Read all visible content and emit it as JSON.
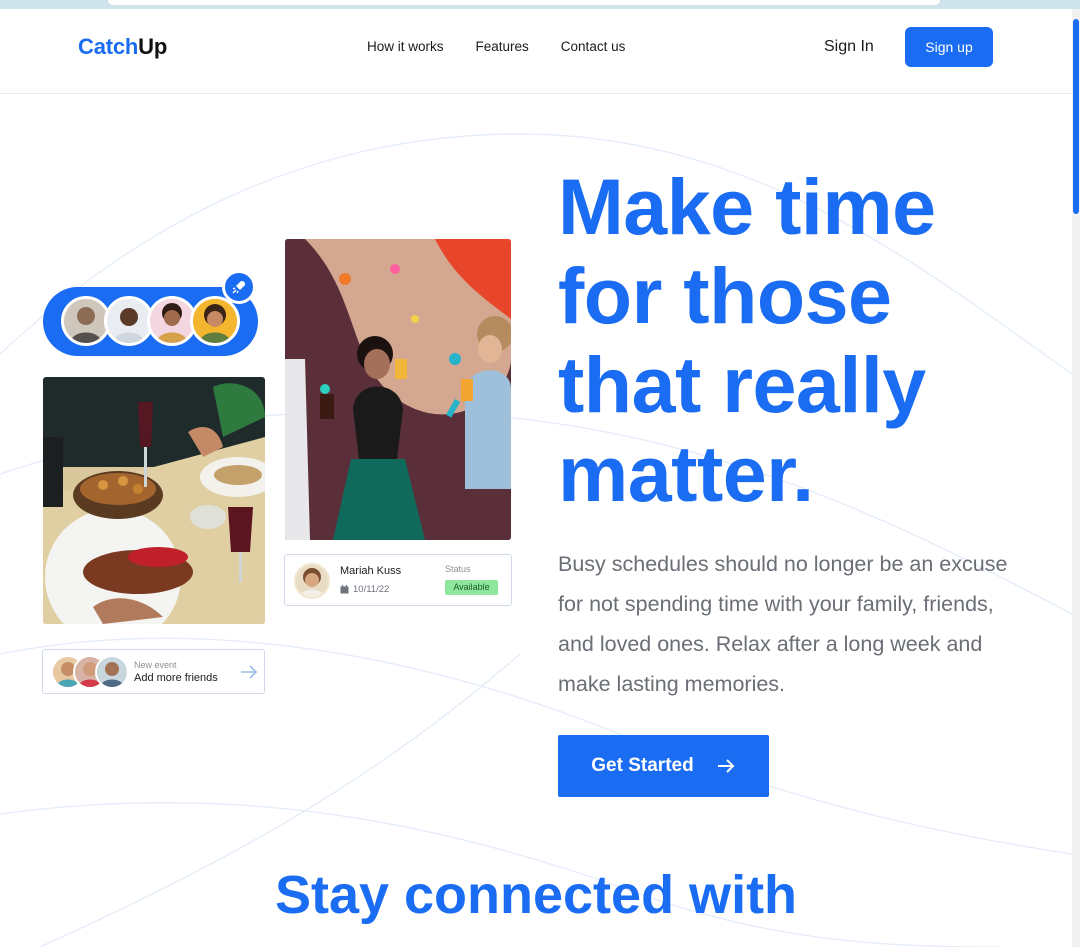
{
  "brand": {
    "logo_part1": "Catch",
    "logo_part2": "Up",
    "accent": "#1a6cf2"
  },
  "nav": {
    "links": [
      "How it works",
      "Features",
      "Contact us"
    ],
    "signin": "Sign In",
    "signup": "Sign up"
  },
  "hero": {
    "title": "Make time for those that really matter.",
    "description": "Busy schedules should no longer be an excuse for not spending time with your family, friends, and loved ones. Relax after a long week and make lasting memories.",
    "cta": "Get Started"
  },
  "friends_card": {
    "small": "New event",
    "main": "Add more friends"
  },
  "status_card": {
    "name": "Mariah Kuss",
    "date": "10/11/22",
    "status_label": "Status",
    "status_value": "Available",
    "status_color": "#8ee79d"
  },
  "icons": {
    "rocket": "rocket-icon",
    "arrow": "arrow-right-icon",
    "calendar": "calendar-icon"
  },
  "next_section": {
    "title": "Stay connected with"
  }
}
